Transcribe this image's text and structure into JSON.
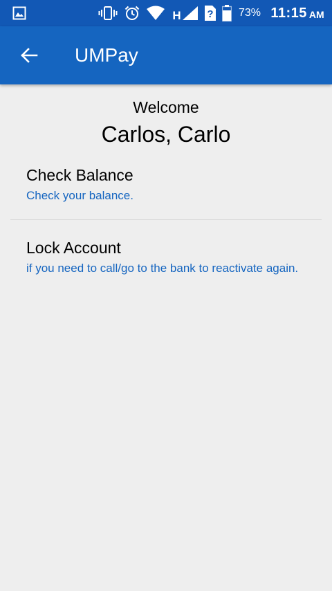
{
  "status_bar": {
    "battery_percent": "73%",
    "time": "11:15",
    "ampm": "AM",
    "network_type": "H",
    "icons": [
      "gallery-icon",
      "vibrate-icon",
      "alarm-icon",
      "wifi-icon",
      "signal-icon",
      "sim-unknown-icon",
      "battery-icon"
    ]
  },
  "app_bar": {
    "back_icon": "arrow-back-icon",
    "title": "UMPay"
  },
  "welcome": {
    "label": "Welcome",
    "name": "Carlos, Carlo"
  },
  "menu": {
    "items": [
      {
        "title": "Check Balance",
        "subtitle": "Check your balance."
      },
      {
        "title": "Lock Account",
        "subtitle": "if you need to call/go to the bank to reactivate again."
      }
    ]
  },
  "colors": {
    "status_bar": "#1258b5",
    "app_bar": "#1565c0",
    "accent_text": "#1565c0",
    "background": "#eeeeee"
  }
}
